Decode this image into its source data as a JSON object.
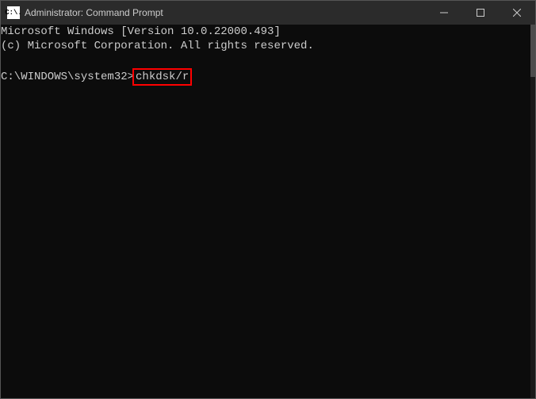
{
  "titlebar": {
    "icon_text": "C:\\.",
    "title": "Administrator: Command Prompt"
  },
  "terminal": {
    "line1": "Microsoft Windows [Version 10.0.22000.493]",
    "line2": "(c) Microsoft Corporation. All rights reserved.",
    "prompt": "C:\\WINDOWS\\system32>",
    "command": "chkdsk/r"
  }
}
